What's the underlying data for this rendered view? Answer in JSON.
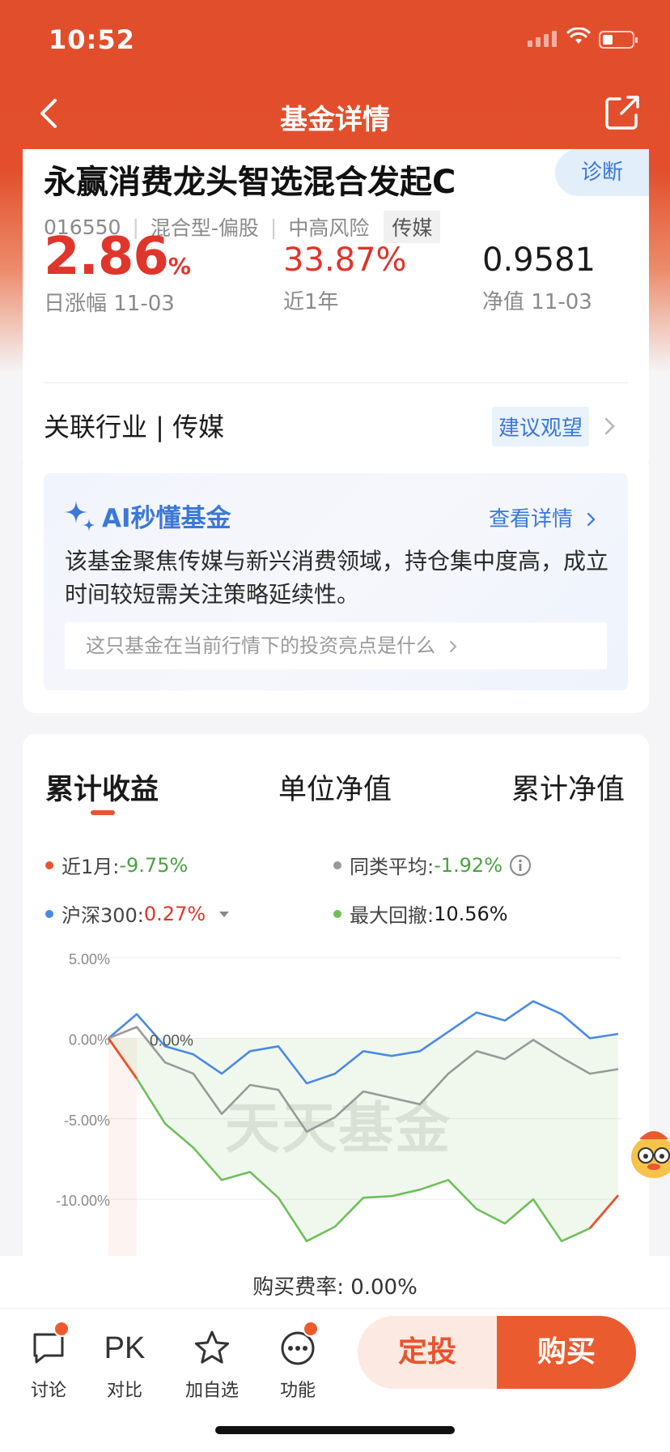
{
  "status_bar": {
    "time": "10:52"
  },
  "nav": {
    "title": "基金详情"
  },
  "fund": {
    "name": "永赢消费龙头智选混合发起C",
    "diagnose_label": "诊断",
    "code": "016550",
    "type": "混合型-偏股",
    "risk": "中高风险",
    "tag": "传媒",
    "separator": "|",
    "daily_change_value": "2.86",
    "daily_change_unit": "%",
    "daily_change_label": "日涨幅 11-03",
    "year_return": "33.87%",
    "year_return_label": "近1年",
    "nav_value": "0.9581",
    "nav_label": "净值 11-03",
    "industry_label": "关联行业 | 传媒",
    "suggestion": "建议观望"
  },
  "ai": {
    "title": "AI秒懂基金",
    "more_label": "查看详情",
    "summary": "该基金聚焦传媒与新兴消费领域，持仓集中度高，成立时间较短需关注策略延续性。",
    "question": "这只基金在当前行情下的投资亮点是什么"
  },
  "chart_tabs": [
    "累计收益",
    "单位净值",
    "累计净值"
  ],
  "legend": {
    "month_label": "近1月:",
    "month_value": "-9.75%",
    "peer_label": "同类平均:",
    "peer_value": "-1.92%",
    "hs300_label": "沪深300:",
    "hs300_value": "0.27%",
    "drawdown_label": "最大回撤:",
    "drawdown_value": "10.56%"
  },
  "colors": {
    "brand": "#e14e2c",
    "fund_line": "#e8542d",
    "peer_line": "#999999",
    "hs300_line": "#4a8ae3",
    "drawdown_line": "#6fbf5a",
    "blue": "#3b78d8",
    "up": "#e0352b",
    "down": "#4aa241"
  },
  "chart_data": {
    "type": "line",
    "y_ticks": [
      "5.00%",
      "0.00%",
      "-5.00%",
      "-10.00%"
    ],
    "ylim": [
      -11.2,
      5.0
    ],
    "start_label": "0.00%",
    "watermark": "天天基金",
    "x": [
      0,
      1,
      2,
      3,
      4,
      5,
      6,
      7,
      8,
      9,
      10,
      11,
      12,
      13,
      14,
      15,
      16,
      17,
      18
    ],
    "series": [
      {
        "name": "沪深300",
        "values": [
          0.0,
          1.5,
          -0.5,
          -1.0,
          -2.2,
          -0.8,
          -0.5,
          -2.8,
          -2.2,
          -0.8,
          -1.1,
          -0.8,
          0.4,
          1.6,
          1.1,
          2.3,
          1.5,
          0.0,
          0.27
        ]
      },
      {
        "name": "同类平均",
        "values": [
          0.0,
          0.7,
          -1.5,
          -2.2,
          -4.7,
          -2.9,
          -3.2,
          -5.8,
          -4.9,
          -3.3,
          -3.7,
          -4.1,
          -2.2,
          -0.8,
          -1.3,
          -0.1,
          -1.2,
          -2.2,
          -1.92
        ]
      },
      {
        "name": "近1月",
        "values": [
          0.0,
          -2.5,
          -5.3,
          -6.8,
          -8.8,
          -8.3,
          -9.9,
          -12.6,
          -11.7,
          -9.9,
          -9.8,
          -9.4,
          -8.8,
          -10.6,
          -11.5,
          -10.0,
          -12.6,
          -11.8,
          -9.75
        ]
      }
    ]
  },
  "bottom": {
    "fee_label": "购买费率: 0.00%",
    "tools": [
      {
        "label": "讨论"
      },
      {
        "label": "对比",
        "icon_text": "PK"
      },
      {
        "label": "加自选"
      },
      {
        "label": "功能"
      }
    ],
    "fixed_invest_label": "定投",
    "buy_label": "购买"
  }
}
